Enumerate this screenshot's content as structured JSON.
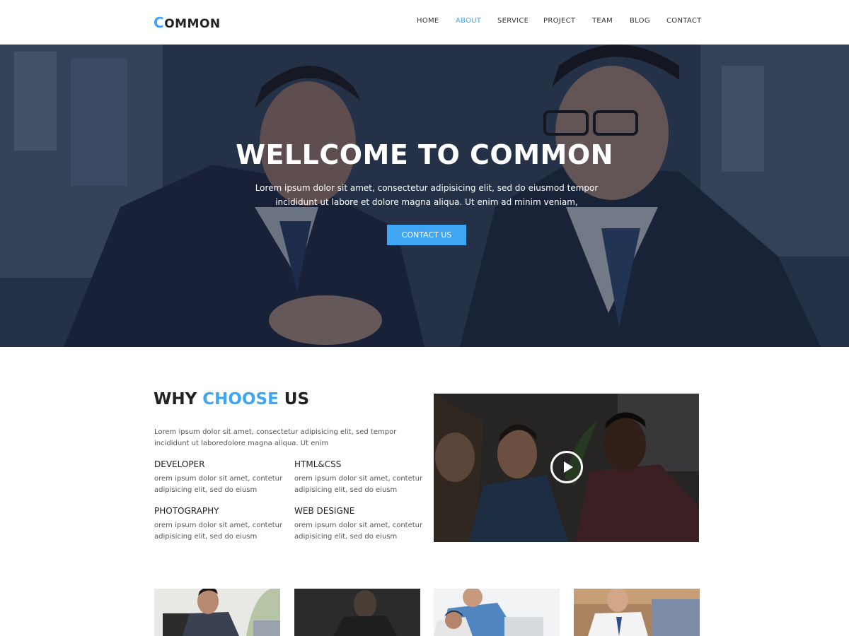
{
  "brand": {
    "first_letter": "C",
    "rest": "OMMON",
    "accent_color": "#3ea6f2"
  },
  "nav": {
    "items": [
      {
        "label": "HOME",
        "active": false
      },
      {
        "label": "ABOUT",
        "active": true
      },
      {
        "label": "SERVICE",
        "active": false
      },
      {
        "label": "PROJECT",
        "active": false
      },
      {
        "label": "TEAM",
        "active": false
      },
      {
        "label": "BLOG",
        "active": false
      },
      {
        "label": "CONTACT",
        "active": false
      }
    ]
  },
  "hero": {
    "title": "WELLCOME TO COMMON",
    "text": "Lorem ipsum dolor sit amet, consectetur adipisicing elit, sed do eiusmod tempor incididunt ut labore et dolore magna aliqua. Ut enim ad minim veniam,",
    "button": "CONTACT US"
  },
  "why": {
    "title_part1": "WHY ",
    "title_accent": "CHOOSE",
    "title_part2": " US",
    "intro": "Lorem ipsum dolor sit amet, consectetur adipisicing elit, sed tempor incididunt ut laboredolore magna aliqua. Ut enim",
    "features": [
      {
        "title": "DEVELOPER",
        "text": "orem ipsum dolor sit amet, contetur adipisicing elit, sed do eiusm"
      },
      {
        "title": "HTML&CSS",
        "text": "orem ipsum dolor sit amet, contetur adipisicing elit, sed do eiusm"
      },
      {
        "title": "PHOTOGRAPHY",
        "text": "orem ipsum dolor sit amet, contetur adipisicing elit, sed do eiusm"
      },
      {
        "title": "WEB DESIGNE",
        "text": "orem ipsum dolor sit amet, contetur adipisicing elit, sed do eiusm"
      }
    ],
    "video_icon": "play-icon"
  }
}
